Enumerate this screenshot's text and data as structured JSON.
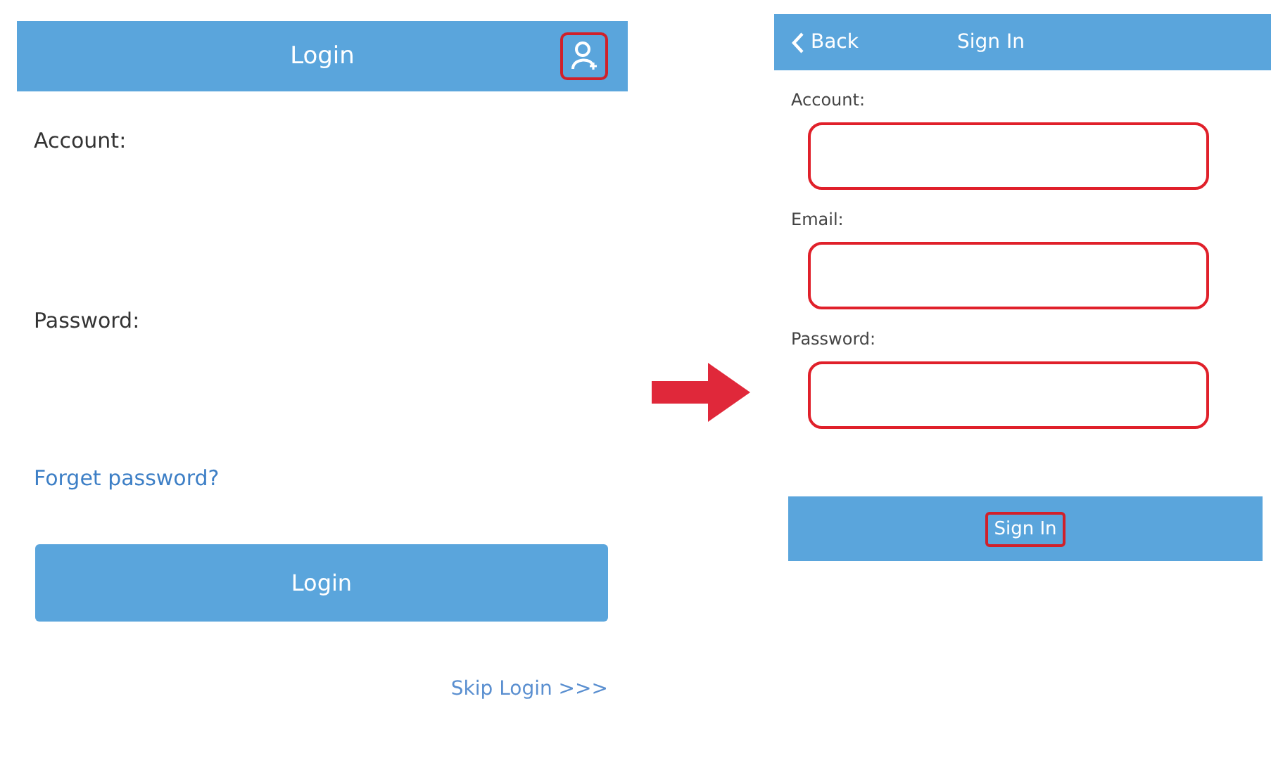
{
  "login_screen": {
    "title": "Login",
    "profile_button": {
      "highlighted": true
    },
    "fields": [
      {
        "label": "Account:"
      },
      {
        "label": "Password:"
      }
    ],
    "forgot_link": "Forget password?",
    "login_button": "Login",
    "skip_link": "Skip Login >>>"
  },
  "signin_screen": {
    "back_button": "Back",
    "title": "Sign In",
    "fields": [
      {
        "label": "Account:",
        "highlighted": true
      },
      {
        "label": "Email:",
        "highlighted": true
      },
      {
        "label": "Password:",
        "highlighted": true
      }
    ],
    "signin_button": {
      "label": "Sign In",
      "highlighted": true
    }
  }
}
